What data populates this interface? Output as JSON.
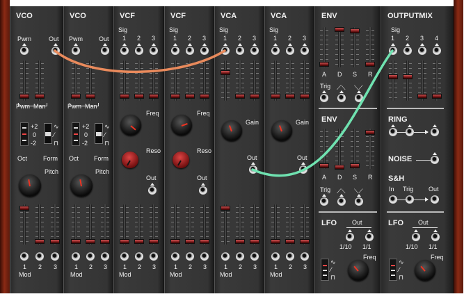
{
  "modules": {
    "vco1": {
      "title": "VCO",
      "pwm": "Pwm",
      "out": "Out",
      "pwm_man": "Pwm",
      "man": "Man",
      "oct": "Oct",
      "form": "Form",
      "pitch": "Pitch",
      "mod": "Mod",
      "oct_values": [
        "+2",
        "0",
        "-2"
      ]
    },
    "vco2": {
      "title": "VCO",
      "pwm": "Pwm",
      "out": "Out",
      "pwm_man": "Pwm",
      "man": "Man",
      "oct": "Oct",
      "form": "Form",
      "pitch": "Pitch",
      "mod": "Mod",
      "oct_values": [
        "+2",
        "0",
        "-2"
      ]
    },
    "vcf1": {
      "title": "VCF",
      "sig": "Sig",
      "inputs": [
        "1",
        "2",
        "3"
      ],
      "freq": "Freq",
      "reso": "Reso",
      "out": "Out",
      "mod": "Mod"
    },
    "vcf2": {
      "title": "VCF",
      "sig": "Sig",
      "inputs": [
        "1",
        "2",
        "3"
      ],
      "freq": "Freq",
      "reso": "Reso",
      "out": "Out",
      "mod": "Mod"
    },
    "vca1": {
      "title": "VCA",
      "sig": "Sig",
      "inputs": [
        "1",
        "2",
        "3"
      ],
      "gain": "Gain",
      "out": "Out",
      "mod": "Mod"
    },
    "vca2": {
      "title": "VCA",
      "sig": "Sig",
      "inputs": [
        "1",
        "2",
        "3"
      ],
      "gain": "Gain",
      "out": "Out",
      "mod": "Mod"
    },
    "env1": {
      "title": "ENV",
      "adsr": [
        "A",
        "D",
        "S",
        "R"
      ],
      "trig": "Trig"
    },
    "env2": {
      "title": "ENV",
      "adsr": [
        "A",
        "D",
        "S",
        "R"
      ],
      "trig": "Trig"
    },
    "lfo1": {
      "title": "LFO",
      "out": "Out",
      "rates": [
        "1/10",
        "1/1"
      ],
      "freq": "Freq"
    },
    "outputmix": {
      "title": "OUTPUTMIX",
      "sig": "Sig",
      "inputs": [
        "1",
        "2",
        "3",
        "4"
      ]
    },
    "ring": {
      "title": "RING"
    },
    "noise": {
      "title": "NOISE"
    },
    "sh": {
      "title": "S&H",
      "in": "In",
      "trig": "Trig",
      "out": "Out"
    },
    "lfo2": {
      "title": "LFO",
      "out": "Out",
      "rates": [
        "1/10",
        "1/1"
      ],
      "freq": "Freq"
    },
    "mod_numbers": [
      "1",
      "2",
      "3"
    ]
  },
  "cables": [
    {
      "name": "vco-out-to-vca-sig-1",
      "color": "#e98a5c"
    },
    {
      "name": "vca-out-to-outputmix-sig-1",
      "color": "#6fe2b0"
    }
  ]
}
